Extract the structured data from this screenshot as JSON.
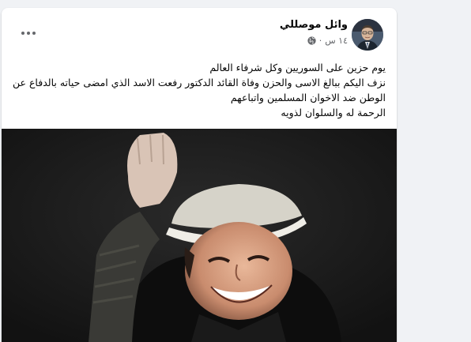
{
  "post": {
    "author": "وائل موصللي",
    "timestamp": "١٤ س",
    "separator": "·",
    "privacy_icon": "globe-icon",
    "more_icon": "more-options-icon",
    "text_lines": [
      "يوم حزين على السوريين وكل شرفاء العالم",
      "نزف اليكم ببالغ الاسى والحزن وفاة القائد الدكتور رفعت الاسد الذي امضى حياته بالدفاع عن",
      "الوطن ضد الاخوان المسلمين واتباعهم",
      "الرحمة له والسلوان لذويه"
    ]
  },
  "colors": {
    "background": "#f0f2f5",
    "card": "#ffffff",
    "text": "#050505",
    "muted": "#65676b"
  }
}
